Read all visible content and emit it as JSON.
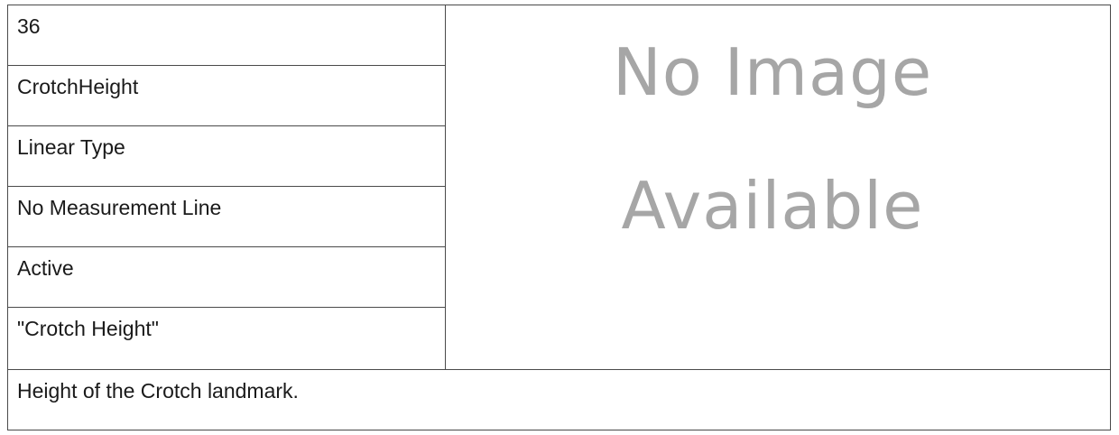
{
  "fields": [
    "36",
    "CrotchHeight",
    "Linear Type",
    "No Measurement Line",
    "Active",
    "\"Crotch Height\""
  ],
  "image_placeholder": {
    "line1": "No Image",
    "line2": "Available"
  },
  "description": "Height of the Crotch landmark."
}
